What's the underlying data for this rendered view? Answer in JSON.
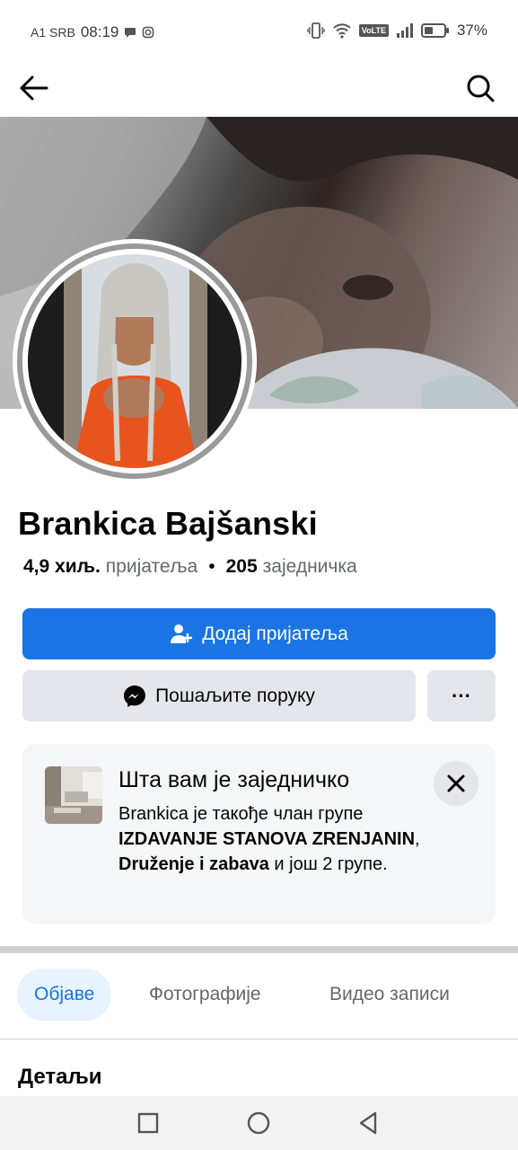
{
  "status_bar": {
    "carrier": "A1 SRB",
    "time": "08:19",
    "volte": "VoLTE",
    "battery": "37%"
  },
  "header": {
    "back_icon": "arrow-left-icon",
    "search_icon": "search-icon"
  },
  "profile": {
    "name": "Brankica Bajšanski",
    "friends_count": "4,9 хиљ.",
    "friends_label": "пријатеља",
    "separator": "•",
    "mutual_count": "205",
    "mutual_label": "заједничка"
  },
  "actions": {
    "add_friend_label": "Додај пријатеља",
    "message_label": "Пошаљите поруку",
    "more_label": "···"
  },
  "common": {
    "title": "Шта вам је заједничко",
    "text_prefix": "Brankica је такође члан групе ",
    "group1": "IZDAVANJE STANOVA ZRENJANIN",
    "comma": ", ",
    "group2": "Druženje i zabava",
    "text_suffix": " и још 2 групе."
  },
  "tabs": [
    {
      "label": "Објаве",
      "active": true
    },
    {
      "label": "Фотографије",
      "active": false
    },
    {
      "label": "Видео записи",
      "active": false
    }
  ],
  "details": {
    "heading": "Детаљи"
  },
  "colors": {
    "primary": "#1b74e4",
    "button_gray": "#e4e6eb",
    "text_secondary": "#65676b"
  }
}
